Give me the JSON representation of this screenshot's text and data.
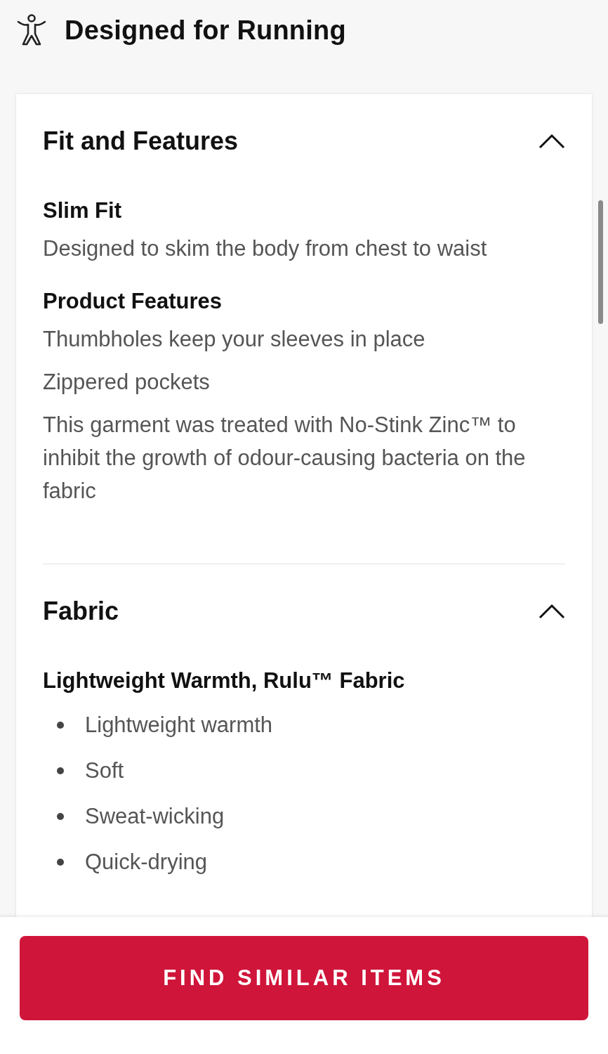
{
  "header": {
    "title": "Designed for Running"
  },
  "sections": [
    {
      "title": "Fit and Features",
      "expanded": true,
      "groups": [
        {
          "heading": "Slim Fit",
          "kind": "text",
          "lines": [
            "Designed to skim the body from chest to waist"
          ]
        },
        {
          "heading": "Product Features",
          "kind": "text",
          "lines": [
            "Thumbholes keep your sleeves in place",
            "Zippered pockets",
            "This garment was treated with No-Stink Zinc™ to inhibit the growth of odour-causing bacteria on the fabric"
          ]
        }
      ]
    },
    {
      "title": "Fabric",
      "expanded": true,
      "groups": [
        {
          "heading": "Lightweight Warmth, Rulu™ Fabric",
          "kind": "bullets",
          "lines": [
            "Lightweight warmth",
            "Soft",
            "Sweat-wicking",
            "Quick-drying"
          ]
        }
      ]
    }
  ],
  "button": {
    "label": "FIND SIMILAR ITEMS"
  }
}
